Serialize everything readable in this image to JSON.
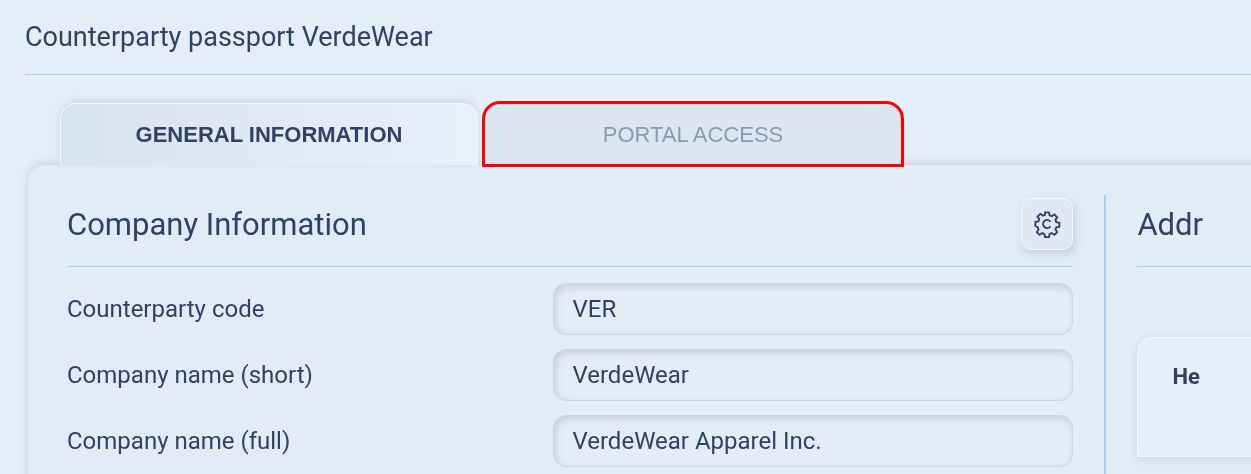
{
  "window": {
    "title": "Counterparty passport VerdeWear"
  },
  "tabs": [
    {
      "label": "GENERAL INFORMATION",
      "selected": true,
      "highlighted": false
    },
    {
      "label": "PORTAL ACCESS",
      "selected": false,
      "highlighted": true
    }
  ],
  "company_section": {
    "title": "Company Information",
    "fields": [
      {
        "label": "Counterparty code",
        "value": "VER"
      },
      {
        "label": "Company name (short)",
        "value": "VerdeWear"
      },
      {
        "label": "Company name (full)",
        "value": "VerdeWear Apparel Inc."
      }
    ]
  },
  "address_section": {
    "title": "Addr",
    "card_title": "He"
  }
}
